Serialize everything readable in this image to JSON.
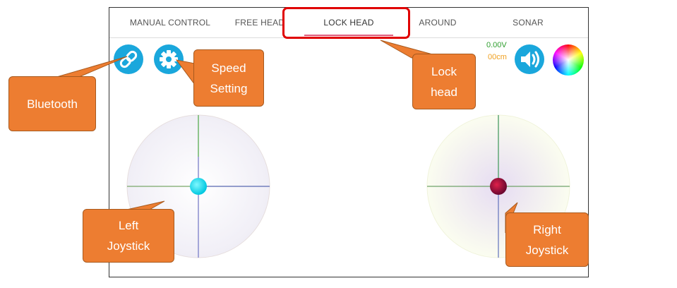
{
  "tabs": [
    {
      "label": "MANUAL CONTROL"
    },
    {
      "label": "FREE HEAD"
    },
    {
      "label": "LOCK HEAD",
      "active": true
    },
    {
      "label": "AROUND"
    },
    {
      "label": "SONAR"
    }
  ],
  "status": {
    "voltage": "0.00V",
    "distance": "00cm"
  },
  "colors": {
    "accent": "#1aa7dc",
    "tab_underline": "#e05a7a",
    "callout": "#ed7d31",
    "highlight": "#e00000",
    "voltage": "#2e9e2e",
    "distance": "#f0a020"
  },
  "callouts": {
    "bluetooth": [
      "Bluetooth"
    ],
    "speed": [
      "Speed",
      "Setting"
    ],
    "lock": [
      "Lock",
      "head"
    ],
    "left_joystick": [
      "Left",
      "Joystick"
    ],
    "right_joystick": [
      "Right",
      "Joystick"
    ]
  },
  "icons": {
    "bluetooth": "link-icon",
    "settings": "gear-icon",
    "sound": "speaker-icon",
    "color": "color-wheel-icon"
  }
}
